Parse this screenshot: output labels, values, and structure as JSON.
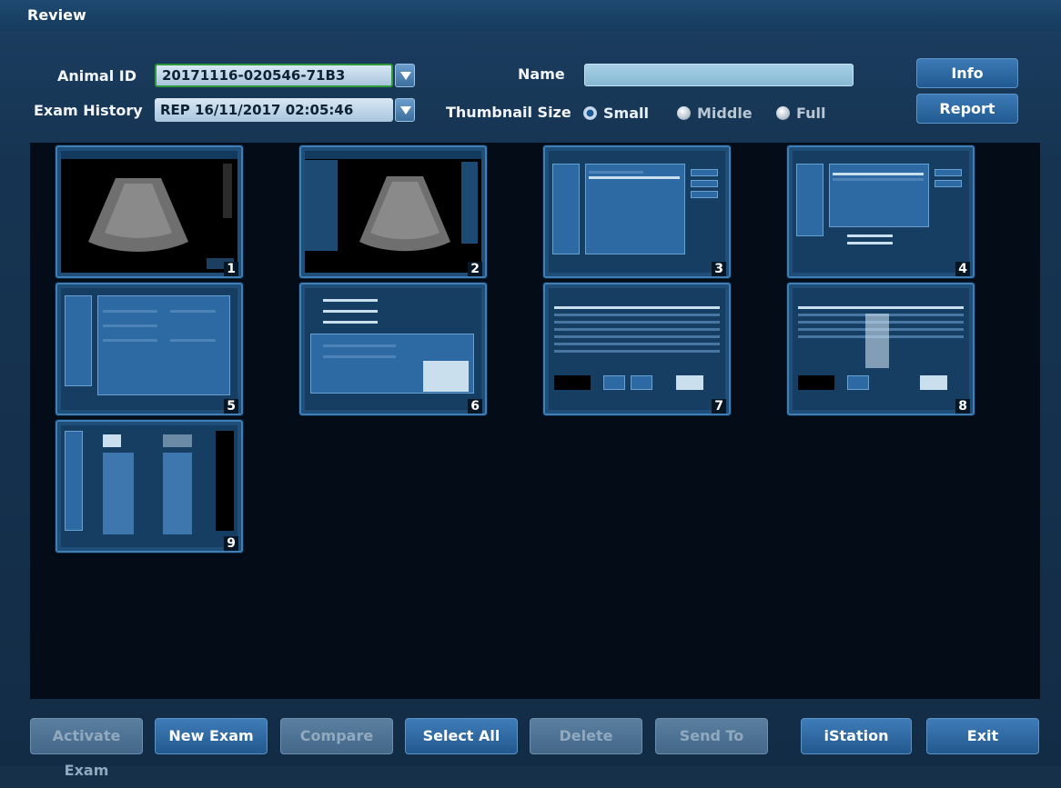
{
  "window": {
    "title": "Review"
  },
  "form": {
    "animal_id_label": "Animal ID",
    "animal_id_value": "20171116-020546-71B3",
    "exam_history_label": "Exam History",
    "exam_history_value": "REP 16/11/2017 02:05:46",
    "name_label": "Name",
    "name_value": "",
    "thumbnail_size_label": "Thumbnail Size",
    "thumbnail_options": [
      "Small",
      "Middle",
      "Full"
    ],
    "thumbnail_selected": "Small"
  },
  "top_buttons": {
    "info": "Info",
    "report": "Report"
  },
  "thumbnails": [
    "1",
    "2",
    "3",
    "4",
    "5",
    "6",
    "7",
    "8",
    "9"
  ],
  "bottom_buttons": {
    "activate_exam": "Activate Exam",
    "new_exam": "New Exam",
    "compare": "Compare",
    "select_all": "Select All",
    "delete": "Delete",
    "send_to": "Send To",
    "istation": "iStation",
    "exit": "Exit"
  },
  "colors": {
    "accent": "#2f6ea8",
    "focus": "#2f9a3a",
    "background": "#17304a"
  }
}
